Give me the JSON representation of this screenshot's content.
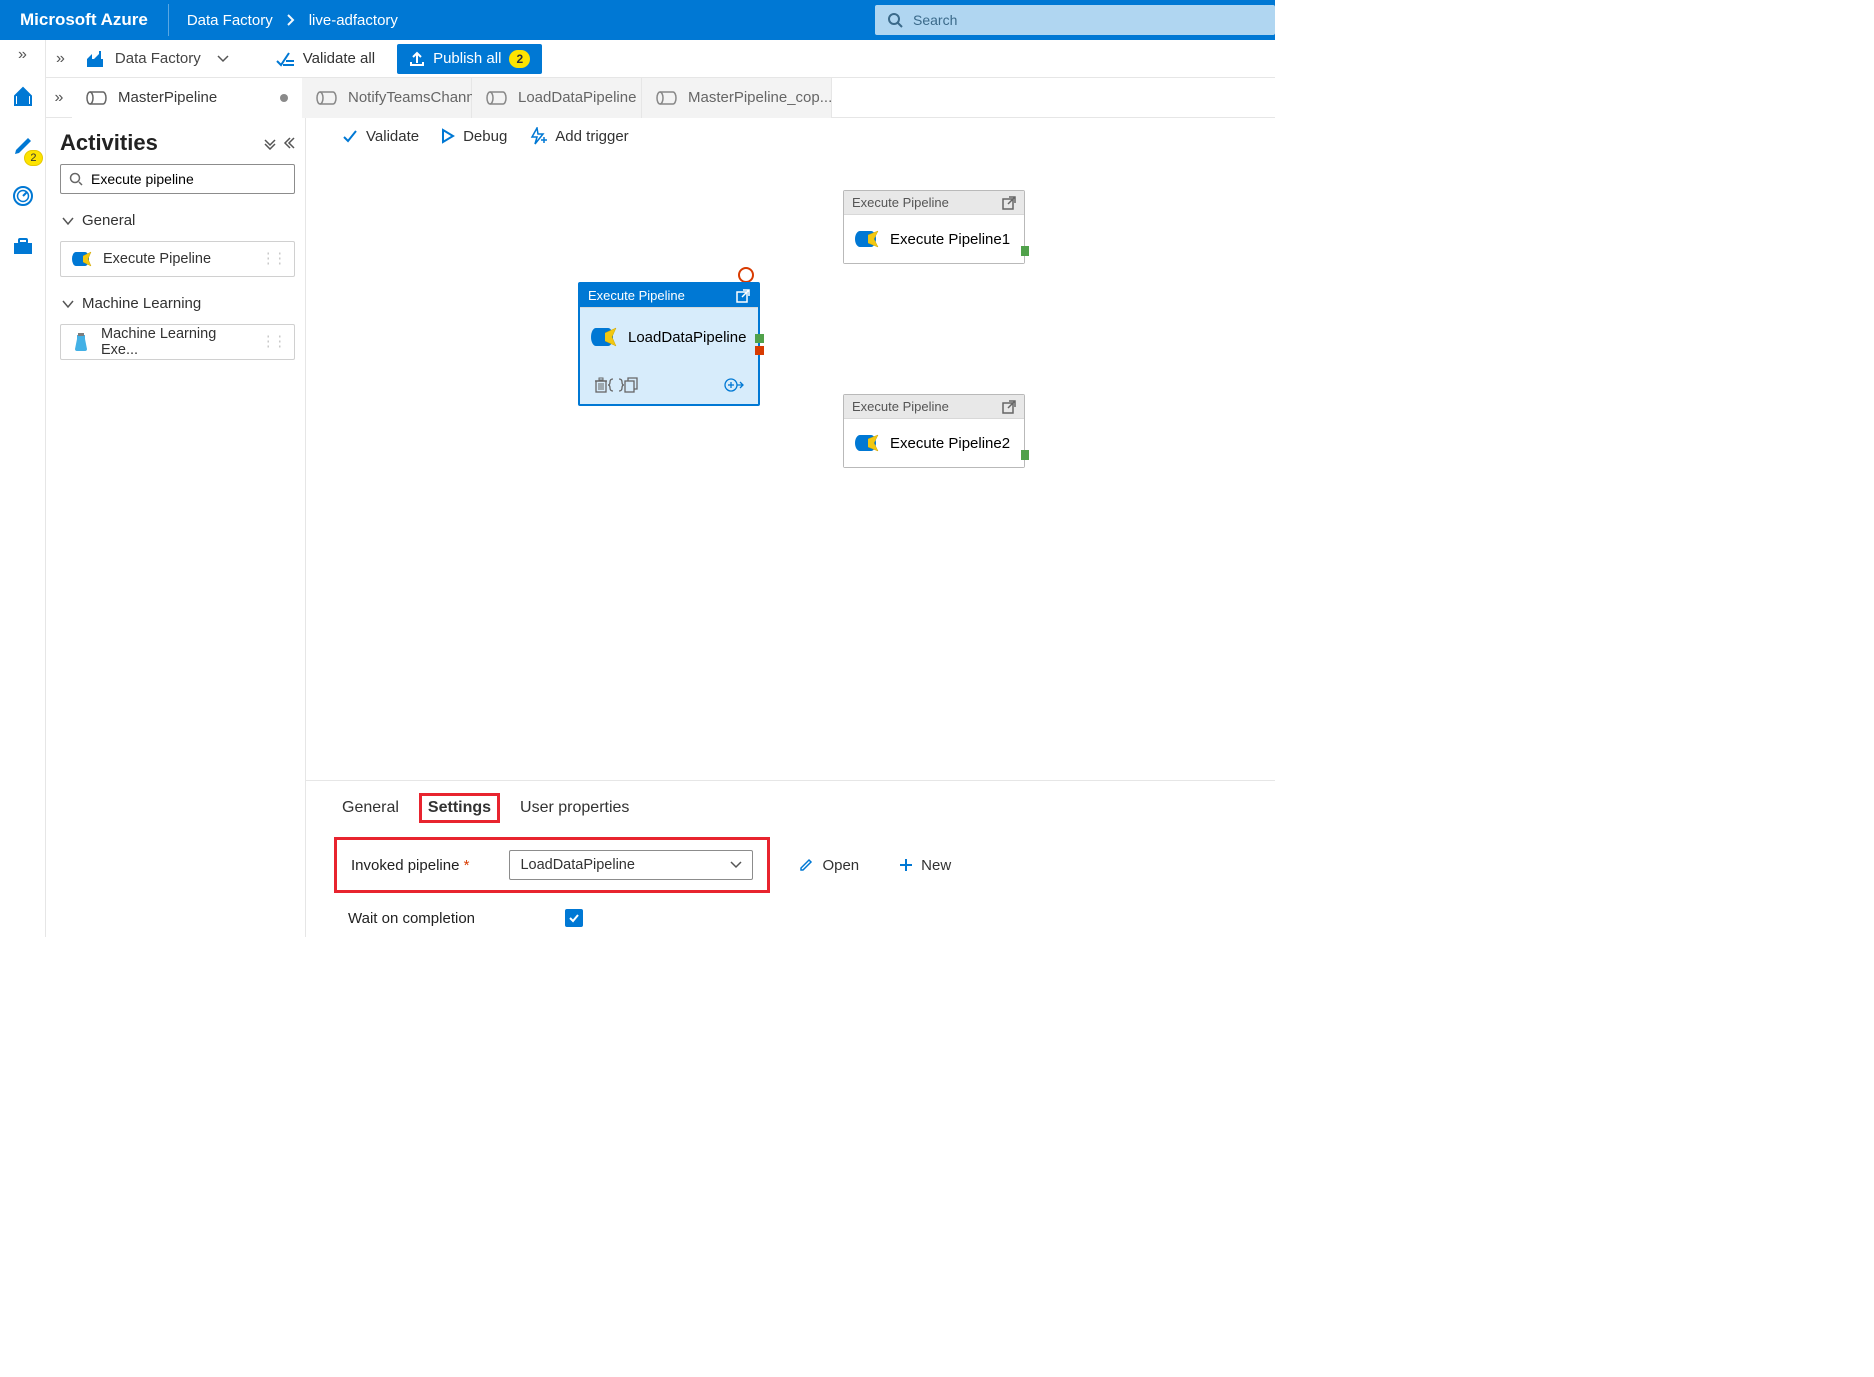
{
  "topbar": {
    "brand": "Microsoft Azure",
    "crumb1": "Data Factory",
    "crumb2": "live-adfactory",
    "search_placeholder": "Search"
  },
  "rail": {
    "pencil_badge": "2"
  },
  "cmdrow": {
    "service": "Data Factory",
    "validate_all": "Validate all",
    "publish_all": "Publish all",
    "publish_count": "2"
  },
  "tabs": {
    "t0": "MasterPipeline",
    "t1": "NotifyTeamsChann...",
    "t2": "LoadDataPipeline",
    "t3": "MasterPipeline_cop..."
  },
  "activities": {
    "title": "Activities",
    "search_value": "Execute pipeline",
    "group_general": "General",
    "item_exec": "Execute Pipeline",
    "group_ml": "Machine Learning",
    "item_ml": "Machine Learning Exe..."
  },
  "canvas_toolbar": {
    "validate": "Validate",
    "debug": "Debug",
    "add_trigger": "Add trigger"
  },
  "nodes": {
    "selected_title": "Execute Pipeline",
    "selected_name": "LoadDataPipeline",
    "n1_title": "Execute Pipeline",
    "n1_name": "Execute Pipeline1",
    "n2_title": "Execute Pipeline",
    "n2_name": "Execute Pipeline2"
  },
  "props": {
    "tab_general": "General",
    "tab_settings": "Settings",
    "tab_userprops": "User properties",
    "invoked_label": "Invoked pipeline",
    "invoked_value": "LoadDataPipeline",
    "open": "Open",
    "new": "New",
    "wait_label": "Wait on completion"
  }
}
